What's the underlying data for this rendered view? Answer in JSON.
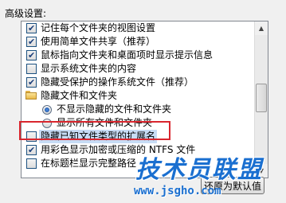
{
  "section_label": "高级设置:",
  "items": [
    {
      "type": "checkbox",
      "checked": true,
      "label": "记住每个文件夹的视图设置"
    },
    {
      "type": "checkbox",
      "checked": true,
      "label": "使用简单文件共享（推荐）"
    },
    {
      "type": "checkbox",
      "checked": true,
      "label": "鼠标指向文件夹和桌面项时显示提示信息"
    },
    {
      "type": "checkbox",
      "checked": false,
      "label": "显示系统文件夹的内容"
    },
    {
      "type": "checkbox",
      "checked": true,
      "label": "隐藏受保护的操作系统文件（推荐）"
    },
    {
      "type": "folder",
      "label": "隐藏文件和文件夹",
      "icon": "folder-icon"
    },
    {
      "type": "radio",
      "checked": true,
      "label": "不显示隐藏的文件和文件夹"
    },
    {
      "type": "radio",
      "checked": false,
      "label": "显示所有文件和文件夹"
    },
    {
      "type": "checkbox",
      "checked": false,
      "label": "隐藏已知文件类型的扩展名",
      "selected": true
    },
    {
      "type": "checkbox",
      "checked": true,
      "label": "用彩色显示加密或压缩的 NTFS 文件"
    },
    {
      "type": "checkbox",
      "checked": false,
      "label": "在标题栏显示完整路径"
    }
  ],
  "restore_button_label": "还原为默认值",
  "watermark": {
    "logo_text": "技术员联盟",
    "url": "www.jsgho.com"
  },
  "colors": {
    "highlight_border": "#d9262e",
    "selection": "#c7dcf5",
    "watermark": "#1a6fd0"
  }
}
